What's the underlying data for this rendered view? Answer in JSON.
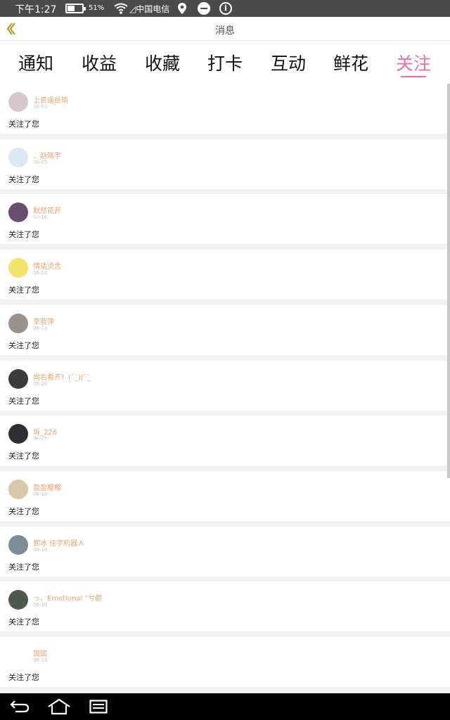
{
  "status": {
    "time": "下午1:27",
    "battery_pct": "51%",
    "battery_level": 0.51,
    "carrier": "◿中国电信"
  },
  "header": {
    "title": "消息",
    "back_icon": "chevron-left-icon",
    "accent_color": "#ee6ea3"
  },
  "tabs": [
    {
      "label": "通知",
      "active": false
    },
    {
      "label": "收益",
      "active": false
    },
    {
      "label": "收藏",
      "active": false
    },
    {
      "label": "打卡",
      "active": false
    },
    {
      "label": "互动",
      "active": false
    },
    {
      "label": "鲜花",
      "active": false
    },
    {
      "label": "关注",
      "active": true
    }
  ],
  "notifications": [
    {
      "name": "上官遥丝琦",
      "date": "10-03",
      "message": "关注了您",
      "avatar_color": "#d9c7cf"
    },
    {
      "name": "、赵晓宇",
      "date": "08-05",
      "message": "关注了您",
      "avatar_color": "#dde6f3"
    },
    {
      "name": "默然花开",
      "date": "07-16",
      "message": "关注了您",
      "avatar_color": "#6a4f72"
    },
    {
      "name": "情话烫舌",
      "date": "06-28",
      "message": "关注了您",
      "avatar_color": "#f2e46a"
    },
    {
      "name": "李蓝萍",
      "date": "06-28",
      "message": "关注了您",
      "avatar_color": "#9a918a"
    },
    {
      "name": "向右看齐！(¯_̀)(¯_̀",
      "date": "06-26",
      "message": "关注了您",
      "avatar_color": "#3c3c3c"
    },
    {
      "name": "坼_226",
      "date": "06-25",
      "message": "关注了您",
      "avatar_color": "#2e2e33"
    },
    {
      "name": "盈盈樱樱",
      "date": "06-19",
      "message": "关注了您",
      "avatar_color": "#d8c7a8"
    },
    {
      "name": "郑冰 佳宇机器人",
      "date": "06-19",
      "message": "关注了您",
      "avatar_color": "#7b8d9b"
    },
    {
      "name": "っ。Emotional °兮颜",
      "date": "06-18",
      "message": "关注了您",
      "avatar_color": "#4f5a4e"
    },
    {
      "name": "国国",
      "date": "06-18",
      "message": "关注了您",
      "avatar_color": "#ffffff"
    }
  ]
}
